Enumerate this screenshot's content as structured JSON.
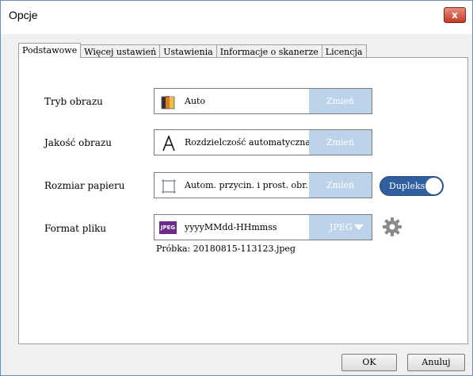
{
  "window": {
    "title": "Opcje",
    "close_label": "x"
  },
  "tabs": [
    {
      "label": "Podstawowe",
      "active": true
    },
    {
      "label": "Więcej ustawień",
      "active": false
    },
    {
      "label": "Ustawienia",
      "active": false
    },
    {
      "label": "Informacje o skanerze",
      "active": false
    },
    {
      "label": "Licencja",
      "active": false
    }
  ],
  "rows": [
    {
      "label": "Tryb obrazu",
      "value": "Auto",
      "button": "Zmień",
      "icon": "color-mode-icon"
    },
    {
      "label": "Jakość obrazu",
      "value": "Rozdzielczość automatyczna",
      "button": "Zmień",
      "icon": "letter-a-icon"
    },
    {
      "label": "Rozmiar papieru",
      "value": "Autom. przycin. i prost. obr.",
      "button": "Zmień",
      "icon": "paper-crop-icon"
    },
    {
      "label": "Format pliku",
      "value": "yyyyMMdd-HHmmss",
      "button": "JPEG",
      "icon": "jpeg-icon",
      "icon_text": "JPEG"
    }
  ],
  "duplex": {
    "label": "Dupleks",
    "on": true
  },
  "sample": "Próbka: 20180815-113123.jpeg",
  "footer": {
    "ok_label": "OK",
    "cancel_label": "Anuluj"
  },
  "colors": {
    "accent": "#2f5f9e",
    "button_disabled": "#bcd3ea",
    "jpeg_badge": "#6b2a8c"
  }
}
